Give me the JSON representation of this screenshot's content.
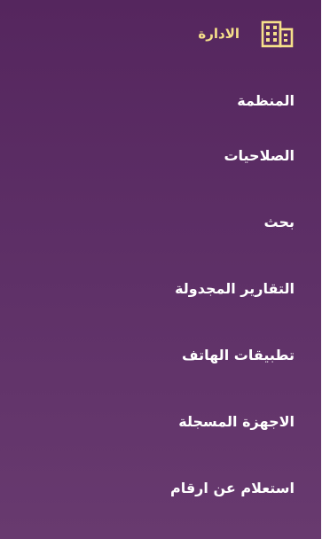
{
  "header": {
    "icon": "building-icon",
    "label": "الادارة",
    "accent_color": "#f6e08a"
  },
  "menu": {
    "items": [
      {
        "label": "المنظمة"
      },
      {
        "label": "الصلاحيات"
      },
      {
        "label": "بحث"
      },
      {
        "label": "التقارير المجدولة"
      },
      {
        "label": "تطبيقات الهاتف"
      },
      {
        "label": "الاجهزة المسجلة"
      },
      {
        "label": "استعلام عن ارقام"
      }
    ]
  },
  "colors": {
    "panel_background": "#5d2f66",
    "item_text": "#ffffff"
  }
}
